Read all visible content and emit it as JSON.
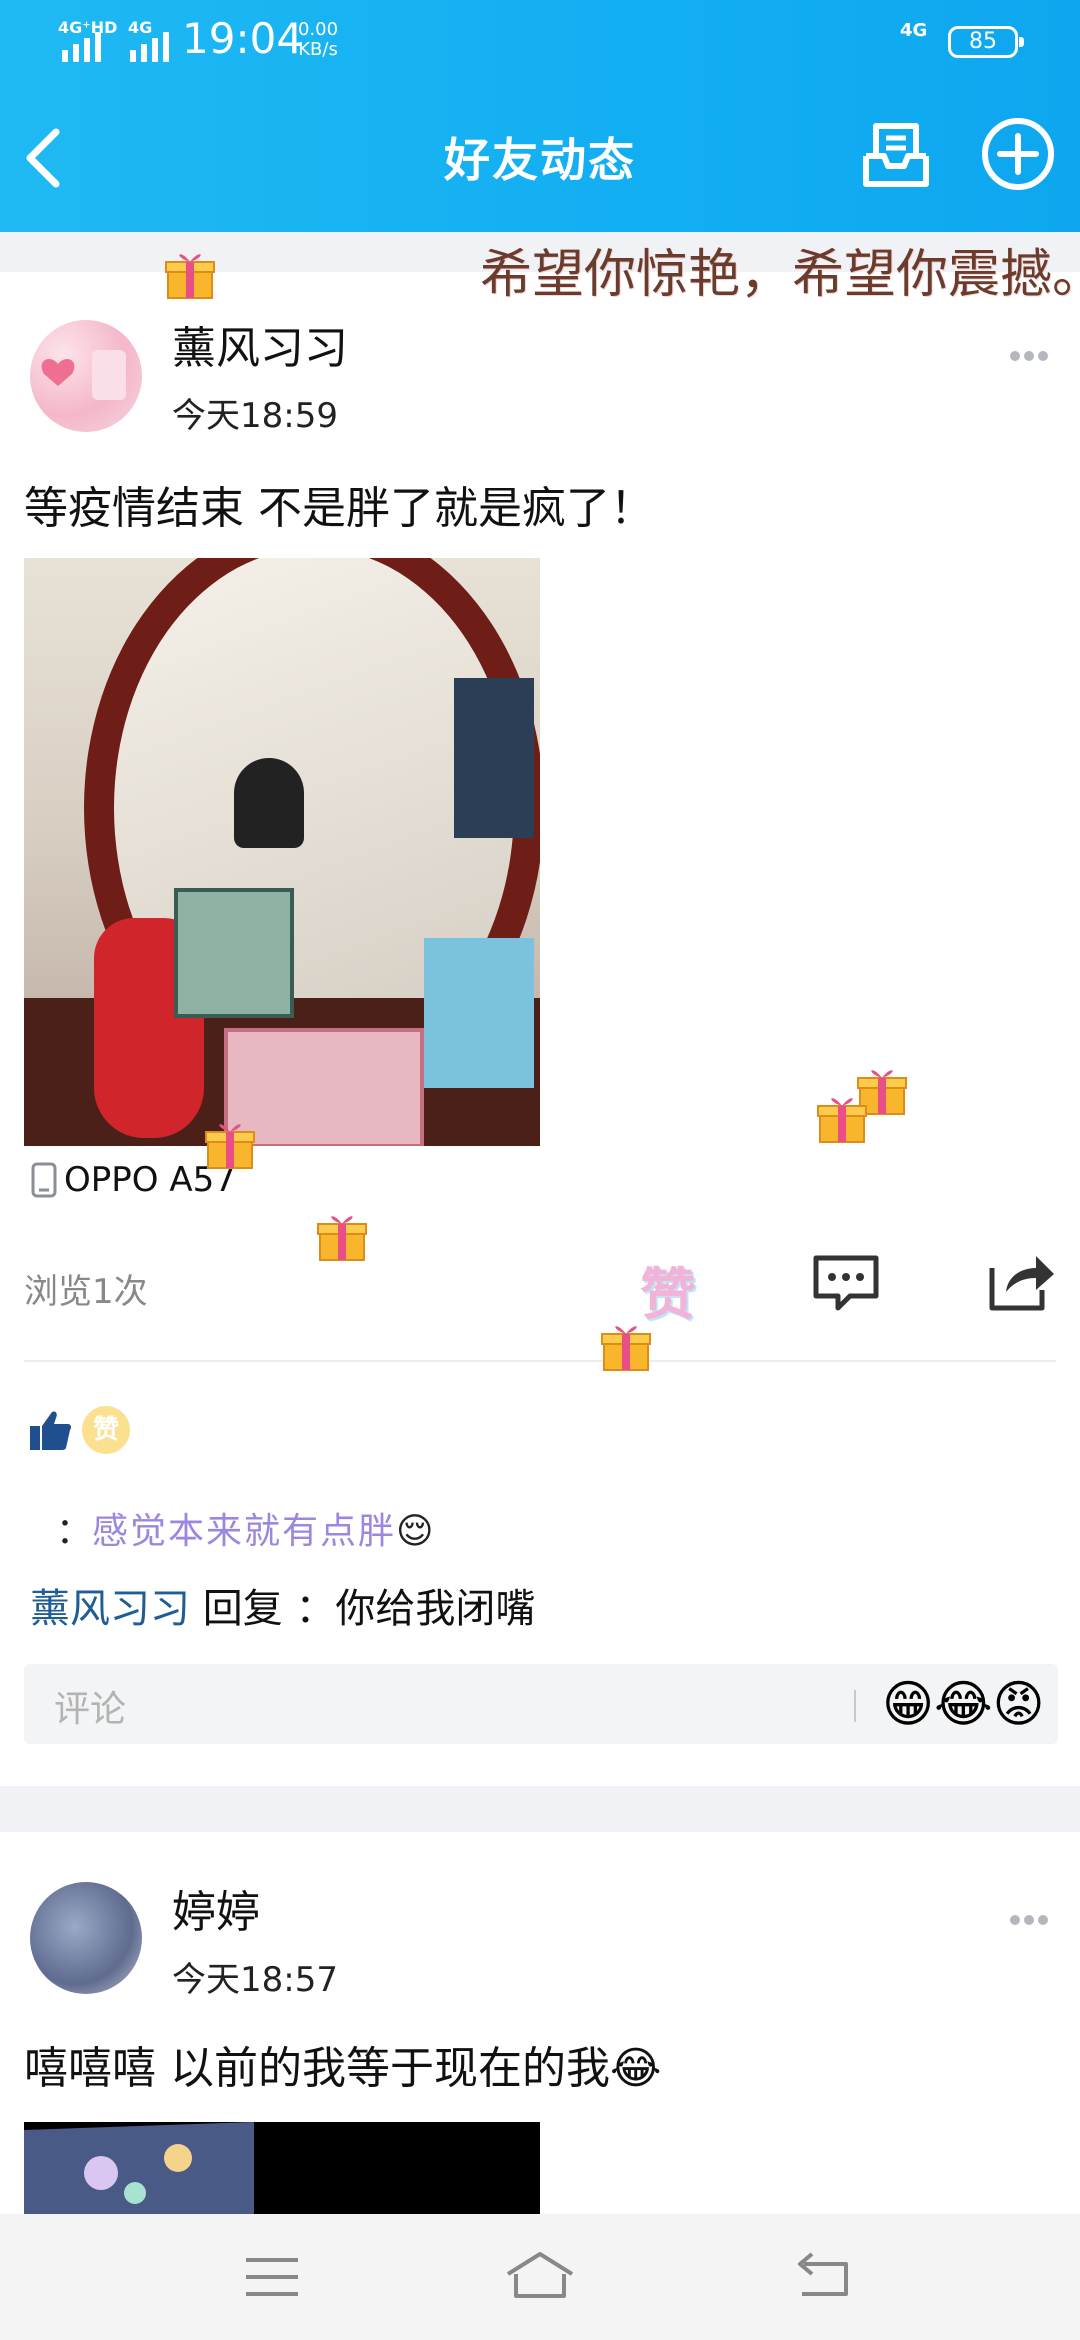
{
  "status_bar": {
    "signal_1": "4G⁺HD",
    "signal_2": "4G",
    "time": "19:04",
    "net_speed_value": "0.00",
    "net_speed_unit": "KB/s",
    "lte_right": "4G",
    "battery": "85"
  },
  "title_bar": {
    "title": "好友动态",
    "back_icon": "chevron-left-icon",
    "msg_icon": "message-box-icon",
    "add_icon": "plus-circle-icon"
  },
  "post1": {
    "decor_banner": "希望你惊艳，希望你震撼。",
    "username": "薰风习习",
    "time": "今天18:59",
    "text": "等疫情结束  不是胖了就是疯了！",
    "device": "OPPO A57",
    "views": "浏览1次",
    "like_label": "赞",
    "zan_badge": "赞",
    "comment_1_prefix": "：",
    "comment_1_text": "感觉本来就有点胖",
    "comment_1_emoji": "😌",
    "reply_name": "薰风习习",
    "reply_word": " 回复 ",
    "reply_text": "  ：你给我闭嘴",
    "comment_placeholder": "评论",
    "emoji_strip": "😁😂😡"
  },
  "post2": {
    "username": "婷婷",
    "time": "今天18:57",
    "text": "嘻嘻嘻  以前的我等于现在的我😂"
  },
  "colors": {
    "header": "#12aef2",
    "link_blue": "#1e5d95",
    "comment_purple": "#9d86e0"
  }
}
